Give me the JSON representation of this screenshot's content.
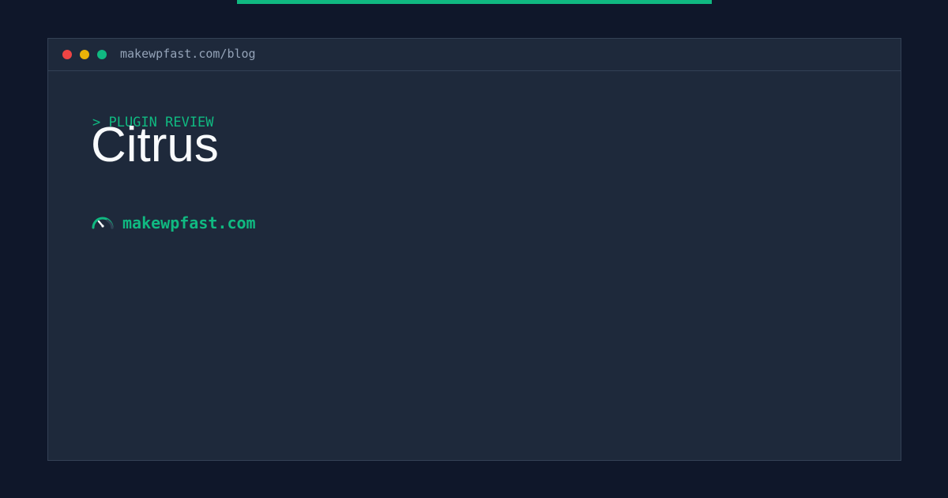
{
  "window": {
    "url": "makewpfast.com/blog"
  },
  "post": {
    "category": "> PLUGIN REVIEW",
    "title": "Citrus"
  },
  "brand": {
    "name": "makewpfast.com",
    "icon": "speedometer-icon"
  },
  "colors": {
    "accent": "#10b981",
    "background": "#0f172a",
    "panel": "#1e293b",
    "title": "#f8fafc",
    "muted": "#94a3b8",
    "traffic_red": "#ef4444",
    "traffic_yellow": "#eab308",
    "traffic_green": "#10b981"
  }
}
